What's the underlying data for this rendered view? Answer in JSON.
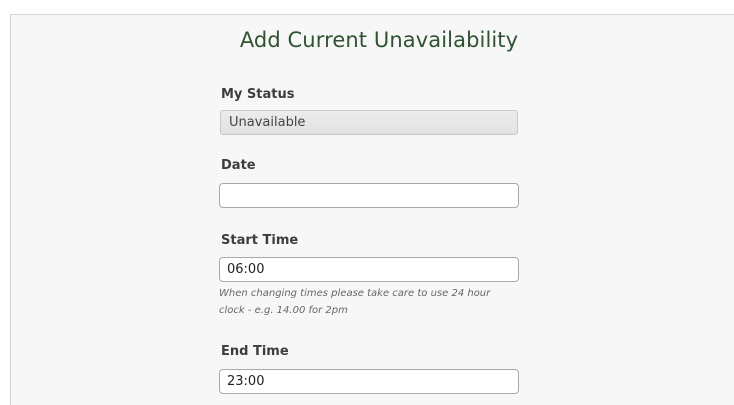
{
  "form": {
    "title": "Add Current Unavailability",
    "status": {
      "label": "My Status",
      "value": "Unavailable"
    },
    "date": {
      "label": "Date",
      "value": ""
    },
    "start_time": {
      "label": "Start Time",
      "value": "06:00",
      "help": "When changing times please take care to use 24 hour clock - e.g. 14.00 for 2pm"
    },
    "end_time": {
      "label": "End Time",
      "value": "23:00"
    }
  }
}
